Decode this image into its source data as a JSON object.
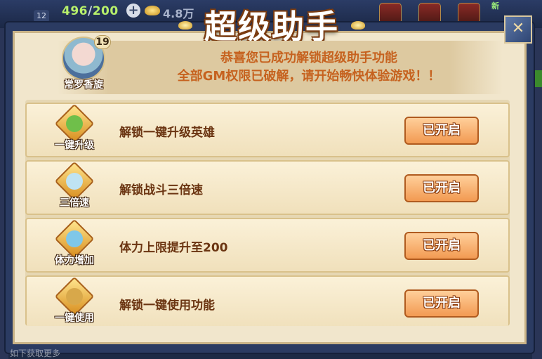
{
  "hud": {
    "badge": "12",
    "stamina_current": "496",
    "stamina_max": "200",
    "gold": "4.8万",
    "new_tag": "新"
  },
  "dialog": {
    "title": "超级助手",
    "close_icon": "close-x-icon"
  },
  "hero": {
    "name": "常罗香旋",
    "level": "19"
  },
  "message": {
    "line1": "恭喜您已成功解锁超级助手功能",
    "line2": "全部GM权限已破解，请开始畅快体验游戏！！"
  },
  "features": [
    {
      "icon": "gold-ingot-icon",
      "caption": "一键升级",
      "label": "解锁一键升级英雄",
      "button": "已开启",
      "color": "#6fbf4a"
    },
    {
      "icon": "winged-boot-icon",
      "caption": "三倍速",
      "label": "解锁战斗三倍速",
      "button": "已开启",
      "color": "#bfe3f2"
    },
    {
      "icon": "stamina-potion-icon",
      "caption": "体力增加",
      "label": "体力上限提升至200",
      "button": "已开启",
      "color": "#7fc7e8"
    },
    {
      "icon": "coin-icon",
      "caption": "一键使用",
      "label": "解锁一键使用功能",
      "button": "已开启",
      "color": "#d8a84a"
    }
  ],
  "footer_text": "如下获取更多"
}
